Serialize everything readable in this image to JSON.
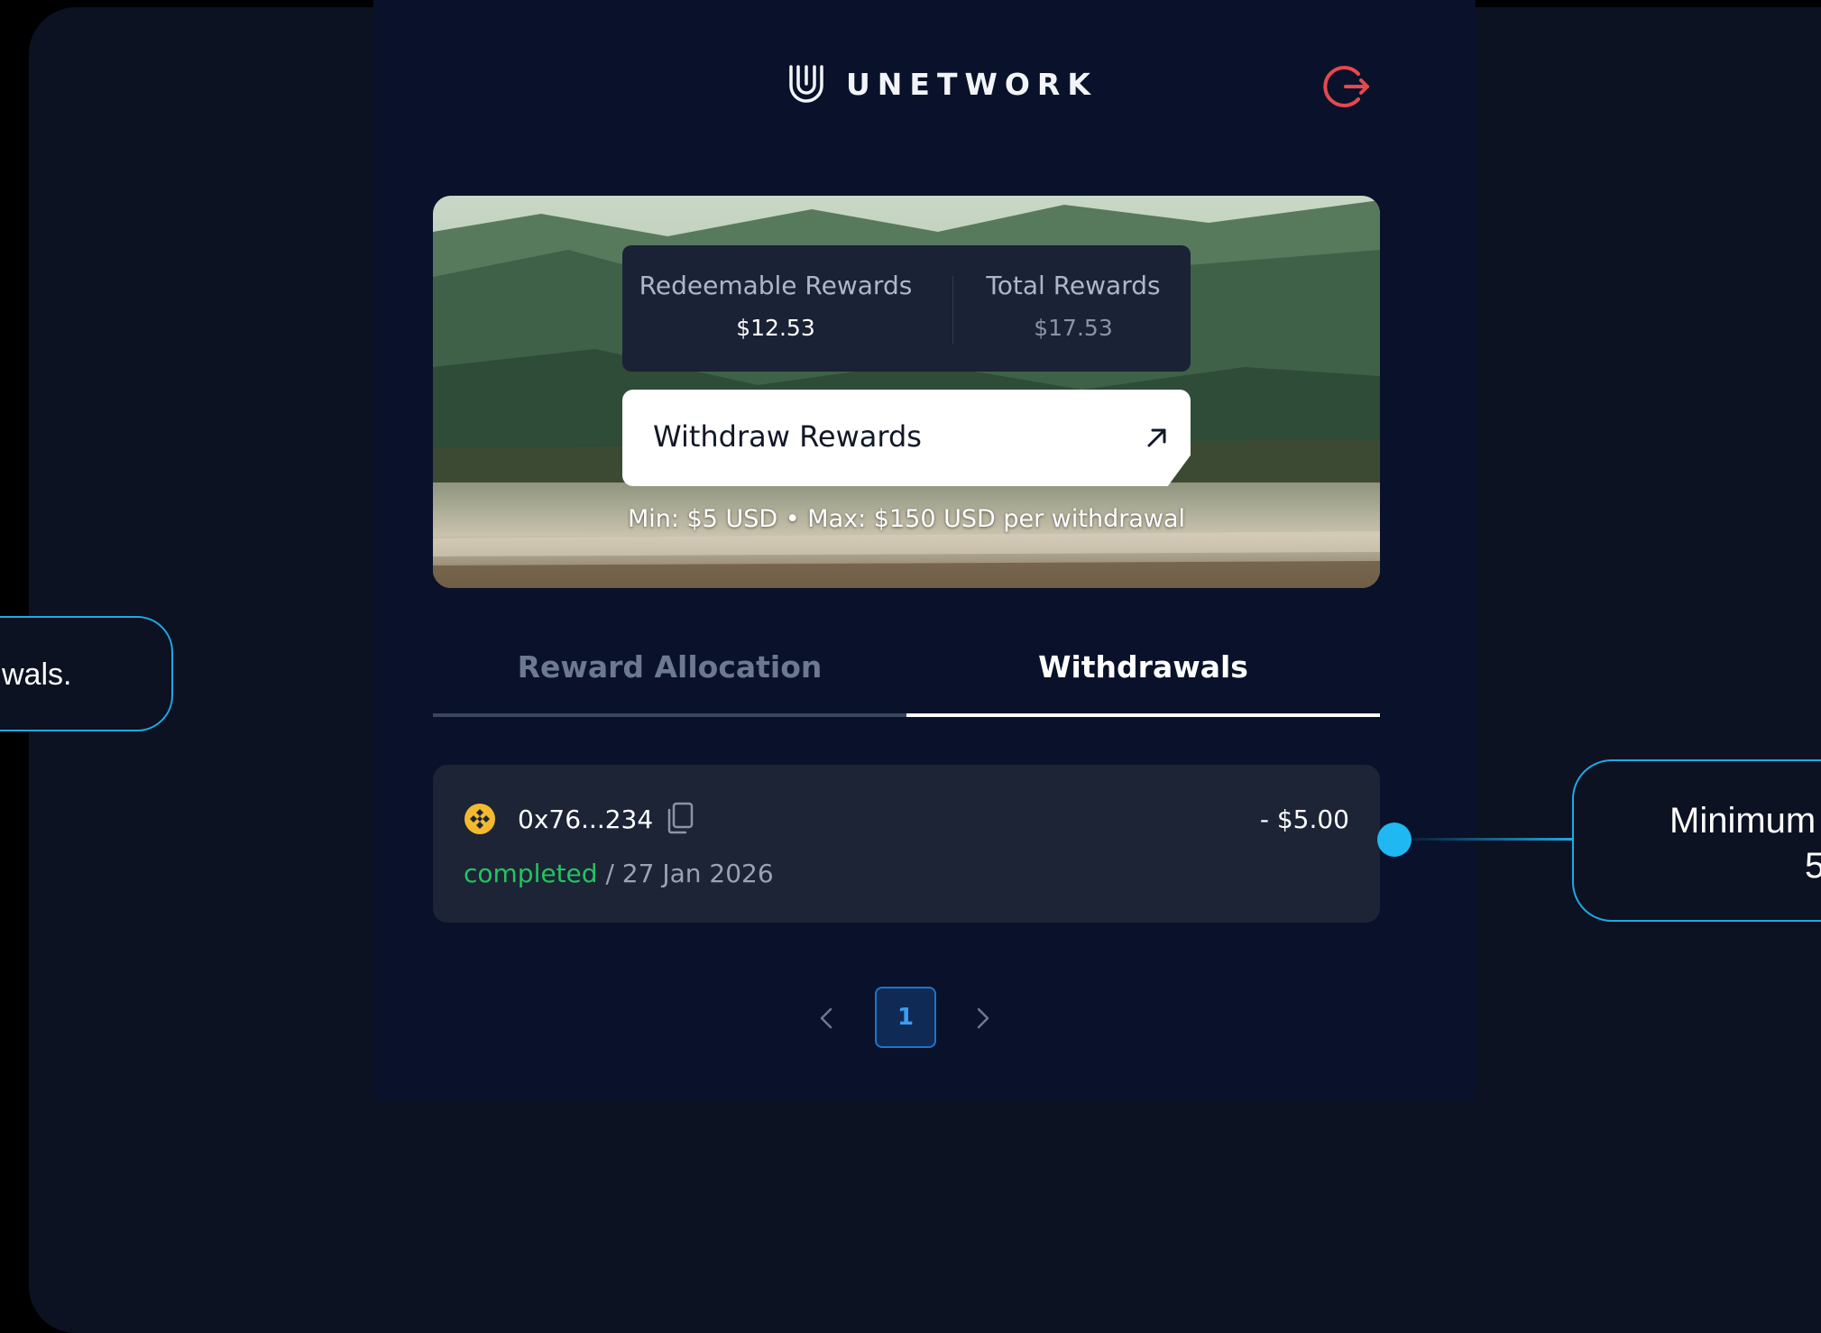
{
  "brand": {
    "name": "UNETWORK",
    "logo_icon": "u-shield-logo-icon"
  },
  "header": {
    "logout_icon": "logout-icon",
    "logout_color": "#e5484d"
  },
  "rewards": {
    "redeemable_label": "Redeemable Rewards",
    "redeemable_value": "$12.53",
    "total_label": "Total Rewards",
    "total_value": "$17.53"
  },
  "withdraw": {
    "button_label": "Withdraw Rewards",
    "button_icon": "arrow-up-right-icon",
    "limits_text": "Min: $5 USD • Max: $150 USD per withdrawal"
  },
  "tabs": [
    {
      "label": "Reward Allocation",
      "active": false
    },
    {
      "label": "Withdrawals",
      "active": true
    }
  ],
  "withdrawals": [
    {
      "token_icon": "bnb-coin-icon",
      "address": "0x76...234",
      "copy_icon": "copy-icon",
      "amount": "- $5.00",
      "status": "completed",
      "date": " / 27 Jan 2026"
    }
  ],
  "pagination": {
    "prev_icon": "chevron-left-icon",
    "current_page": "1",
    "next_icon": "chevron-right-icon"
  },
  "callouts": {
    "left_text": "wals.",
    "right_line1": "Minimum",
    "right_line2": "5"
  },
  "colors": {
    "background": "#0c1221",
    "panel": "#09122a",
    "card": "#1c2436",
    "accent": "#1fa9e6",
    "status_completed": "#22c55e",
    "page_active": "#3b9cf0"
  }
}
